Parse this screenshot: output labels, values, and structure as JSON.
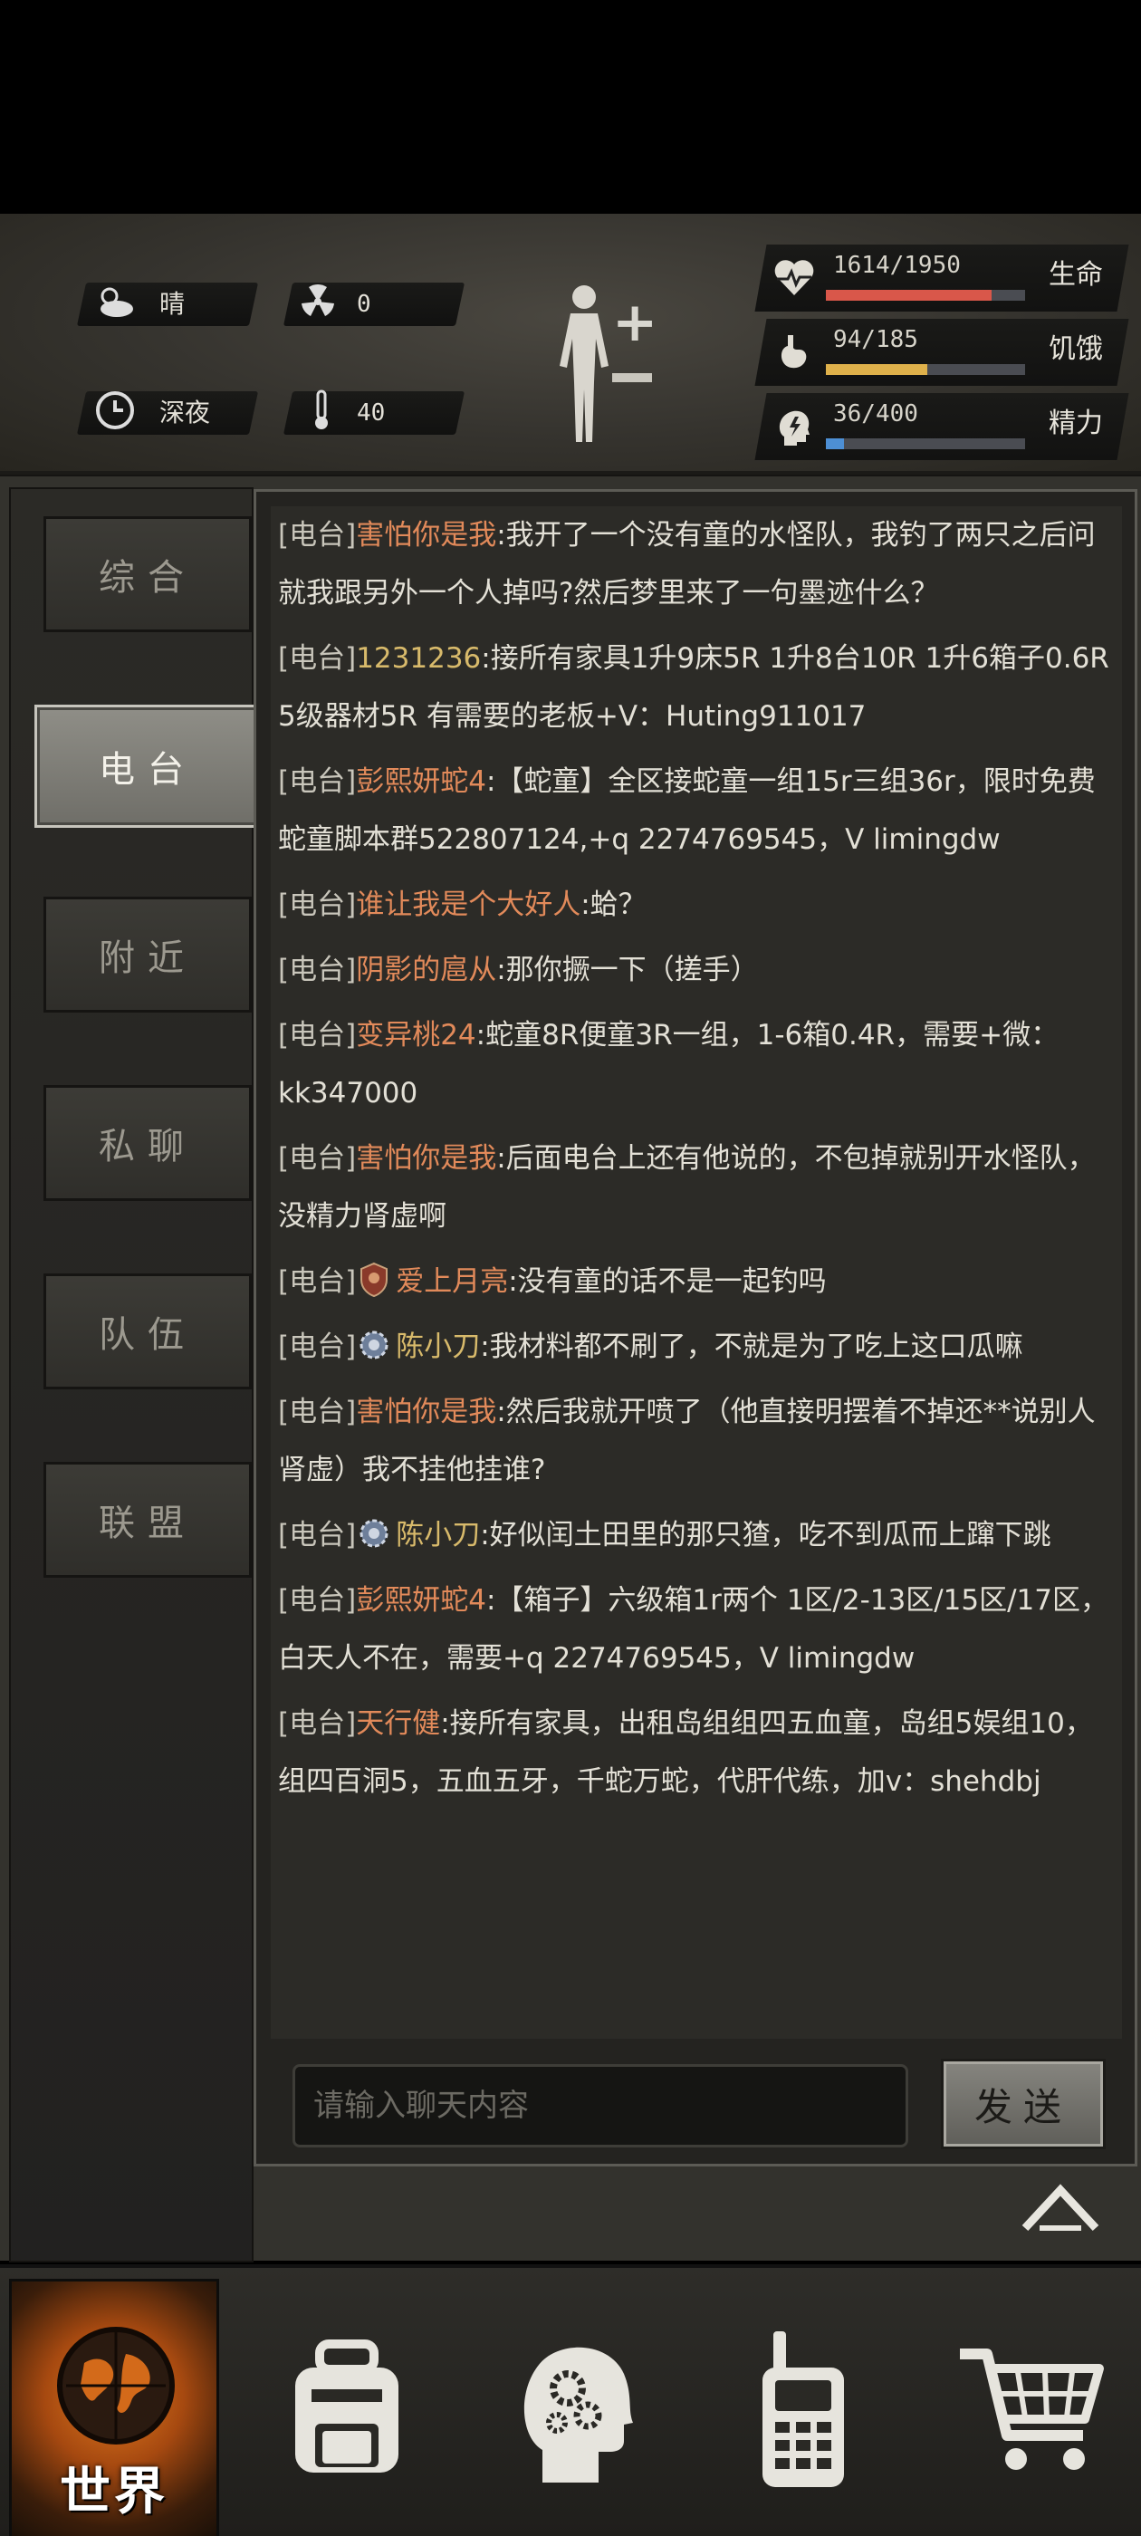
{
  "status": {
    "weather": "晴",
    "radiation": "0",
    "time_of_day": "深夜",
    "temperature": "40"
  },
  "vitals": [
    {
      "value": "1614/1950",
      "label": "生命",
      "fill": 0.83,
      "color": "#d9574a",
      "icon": "heart-pulse-icon"
    },
    {
      "value": "94/185",
      "label": "饥饿",
      "fill": 0.51,
      "color": "#dfb14b",
      "icon": "stomach-icon"
    },
    {
      "value": "36/400",
      "label": "精力",
      "fill": 0.09,
      "color": "#4d8fd4",
      "icon": "head-energy-icon"
    }
  ],
  "tabs": [
    "综合",
    "电台",
    "附近",
    "私聊",
    "队伍",
    "联盟"
  ],
  "active_tab": "电台",
  "messages": [
    {
      "channel": "[电台]",
      "sender": "害怕你是我",
      "color": "orange",
      "text": ":我开了一个没有童的水怪队，我钓了两只之后问就我跟另外一个人掉吗?然后梦里来了一句墨迹什么？"
    },
    {
      "channel": "[电台]",
      "sender": "1231236",
      "color": "yellow",
      "text": ":接所有家具1升9床5R 1升8台10R 1升6箱子0.6R 5级器材5R 有需要的老板+V：Huting911017"
    },
    {
      "channel": "[电台]",
      "sender": "彭熙妍蛇4",
      "color": "orange",
      "text": ":【蛇童】全区接蛇童一组15r三组36r，限时免费蛇童脚本群522807124,+q 2274769545，V limingdw"
    },
    {
      "channel": "[电台]",
      "sender": "谁让我是个大好人",
      "color": "orange",
      "text": ":蛤？"
    },
    {
      "channel": "[电台]",
      "sender": "阴影的扈从",
      "color": "orange",
      "text": ":那你撅一下（搓手）"
    },
    {
      "channel": "[电台]",
      "sender": "变异桃24",
      "color": "orange",
      "text": ":蛇童8R便童3R一组，1-6箱0.4R，需要+微：kk347000"
    },
    {
      "channel": "[电台]",
      "sender": "害怕你是我",
      "color": "orange",
      "text": ":后面电台上还有他说的，不包掉就别开水怪队，没精力肾虚啊"
    },
    {
      "channel": "[电台]",
      "sender": "爱上月亮",
      "color": "orange",
      "avatar": "shield-badge-icon",
      "text": ":没有童的话不是一起钓吗"
    },
    {
      "channel": "[电台]",
      "sender": "陈小刀",
      "color": "yellow",
      "avatar": "gear-badge-icon",
      "text": ":我材料都不刷了，不就是为了吃上这口瓜嘛"
    },
    {
      "channel": "[电台]",
      "sender": "害怕你是我",
      "color": "orange",
      "text": ":然后我就开喷了（他直接明摆着不掉还**说别人肾虚）我不挂他挂谁?"
    },
    {
      "channel": "[电台]",
      "sender": "陈小刀",
      "color": "yellow",
      "avatar": "gear-badge-icon",
      "text": ":好似闰土田里的那只猹，吃不到瓜而上蹿下跳"
    },
    {
      "channel": "[电台]",
      "sender": "彭熙妍蛇4",
      "color": "orange",
      "text": ":【箱子】六级箱1r两个 1区/2-13区/15区/17区，白天人不在，需要+q 2274769545，V limingdw"
    },
    {
      "channel": "[电台]",
      "sender": "天行健",
      "color": "orange",
      "text": ":接所有家具，出租岛组组四五血童，岛组5娱组10，组四百洞5，五血五牙，千蛇万蛇，代肝代练，加v：shehdbj"
    }
  ],
  "chat_input": {
    "placeholder": "请输入聊天内容"
  },
  "send_label": "发送",
  "bottom_nav": [
    {
      "icon": "globe-icon",
      "label": "世界",
      "active": true
    },
    {
      "icon": "backpack-icon",
      "label": "",
      "active": false
    },
    {
      "icon": "head-gears-icon",
      "label": "",
      "active": false
    },
    {
      "icon": "walkie-talkie-icon",
      "label": "",
      "active": false
    },
    {
      "icon": "shopping-cart-icon",
      "label": "",
      "active": false
    }
  ]
}
